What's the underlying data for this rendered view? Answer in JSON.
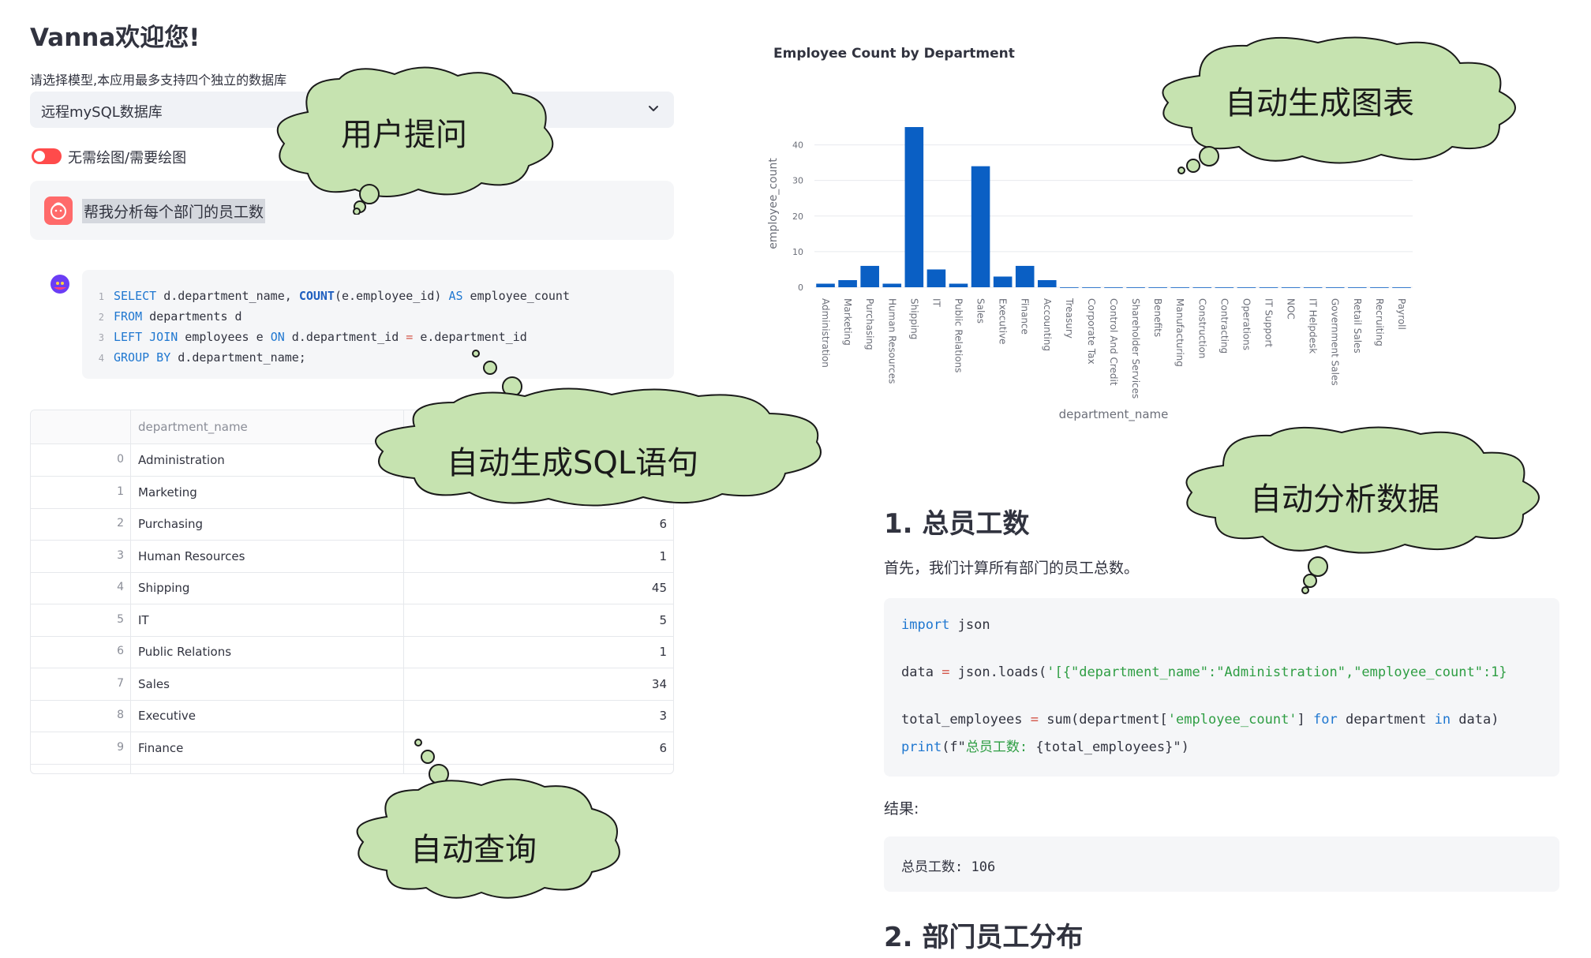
{
  "app": {
    "title": "Vanna欢迎您!",
    "subtitle": "请选择模型,本应用最多支持四个独立的数据库",
    "selected_db": "远程mySQL数据库",
    "toggle_label": "无需绘图/需要绘图",
    "toggle_on": true
  },
  "user_message": "帮我分析每个部门的员工数",
  "sql": {
    "lines": [
      {
        "n": "1",
        "parts": [
          [
            "kw",
            "SELECT"
          ],
          [
            "plain",
            " d.department_name, "
          ],
          [
            "fn",
            "COUNT"
          ],
          [
            "plain",
            "(e.employee_id) "
          ],
          [
            "kw",
            "AS"
          ],
          [
            "plain",
            " employee_count"
          ]
        ]
      },
      {
        "n": "2",
        "parts": [
          [
            "kw",
            "FROM"
          ],
          [
            "plain",
            " departments d"
          ]
        ]
      },
      {
        "n": "3",
        "parts": [
          [
            "kw",
            "LEFT JOIN"
          ],
          [
            "plain",
            " employees e "
          ],
          [
            "kw",
            "ON"
          ],
          [
            "plain",
            " d.department_id "
          ],
          [
            "op",
            "="
          ],
          [
            "plain",
            " e.department_id"
          ]
        ]
      },
      {
        "n": "4",
        "parts": [
          [
            "kw",
            "GROUP BY"
          ],
          [
            "plain",
            " d.department_name;"
          ]
        ]
      }
    ]
  },
  "table": {
    "header": "department_name",
    "rows": [
      {
        "idx": "0",
        "name": "Administration",
        "value": ""
      },
      {
        "idx": "1",
        "name": "Marketing",
        "value": ""
      },
      {
        "idx": "2",
        "name": "Purchasing",
        "value": "6"
      },
      {
        "idx": "3",
        "name": "Human Resources",
        "value": "1"
      },
      {
        "idx": "4",
        "name": "Shipping",
        "value": "45"
      },
      {
        "idx": "5",
        "name": "IT",
        "value": "5"
      },
      {
        "idx": "6",
        "name": "Public Relations",
        "value": "1"
      },
      {
        "idx": "7",
        "name": "Sales",
        "value": "34"
      },
      {
        "idx": "8",
        "name": "Executive",
        "value": "3"
      },
      {
        "idx": "9",
        "name": "Finance",
        "value": "6"
      }
    ]
  },
  "chart_data": {
    "type": "bar",
    "title": "Employee Count by Department",
    "xlabel": "department_name",
    "ylabel": "employee_count",
    "ylim": [
      0,
      47
    ],
    "yticks": [
      0,
      10,
      20,
      30,
      40
    ],
    "grid": true,
    "color": "#0a5fc4",
    "categories": [
      "Administration",
      "Marketing",
      "Purchasing",
      "Human Resources",
      "Shipping",
      "IT",
      "Public Relations",
      "Sales",
      "Executive",
      "Finance",
      "Accounting",
      "Treasury",
      "Corporate Tax",
      "Control And Credit",
      "Shareholder Services",
      "Benefits",
      "Manufacturing",
      "Construction",
      "Contracting",
      "Operations",
      "IT Support",
      "NOC",
      "IT Helpdesk",
      "Government Sales",
      "Retail Sales",
      "Recruiting",
      "Payroll"
    ],
    "values": [
      1,
      2,
      6,
      1,
      45,
      5,
      1,
      34,
      3,
      6,
      2,
      0,
      0,
      0,
      0,
      0,
      0,
      0,
      0,
      0,
      0,
      0,
      0,
      0,
      0,
      0,
      0
    ]
  },
  "analysis": {
    "heading1": "1. 总员工数",
    "para": "首先，我们计算所有部门的员工总数。",
    "code_lines": [
      [
        [
          "blue",
          "import"
        ],
        [
          "plain",
          " json"
        ]
      ],
      [
        [
          "plain",
          ""
        ]
      ],
      [
        [
          "plain",
          "data "
        ],
        [
          "op",
          "="
        ],
        [
          "plain",
          " json.loads("
        ],
        [
          "str",
          "'[{\"department_name\":\"Administration\",\"employee_count\":1}"
        ]
      ],
      [
        [
          "plain",
          ""
        ]
      ],
      [
        [
          "plain",
          "total_employees "
        ],
        [
          "op",
          "="
        ],
        [
          "plain",
          " sum(department["
        ],
        [
          "str",
          "'employee_count'"
        ],
        [
          "plain",
          "] "
        ],
        [
          "blue",
          "for"
        ],
        [
          "plain",
          " department "
        ],
        [
          "blue",
          "in"
        ],
        [
          "plain",
          " data)"
        ]
      ],
      [
        [
          "blue",
          "print"
        ],
        [
          "plain",
          "(f\""
        ],
        [
          "str",
          "总员工数: "
        ],
        [
          "plain",
          "{total_employees}\")"
        ]
      ]
    ],
    "result_label": "结果:",
    "result_value": "总员工数: 106",
    "heading2": "2. 部门员工分布"
  },
  "clouds": {
    "user_question": "用户提问",
    "auto_chart": "自动生成图表",
    "auto_sql": "自动生成SQL语句",
    "auto_analysis": "自动分析数据",
    "auto_query": "自动查询"
  }
}
